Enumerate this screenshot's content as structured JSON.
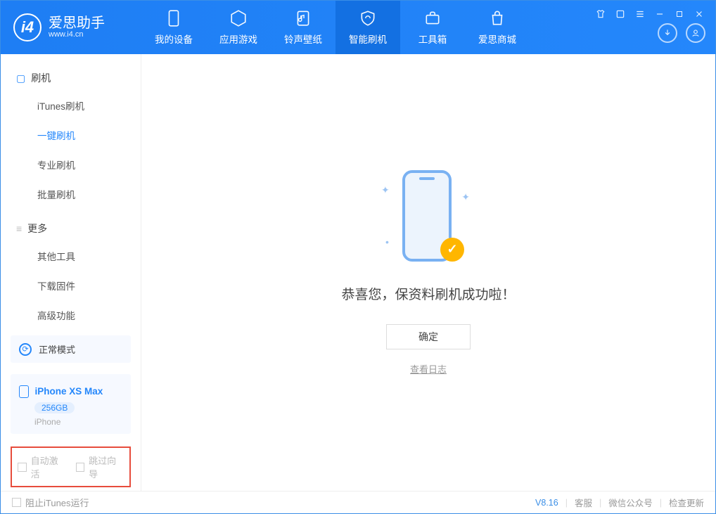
{
  "app": {
    "name": "爱思助手",
    "url": "www.i4.cn"
  },
  "tabs": [
    {
      "label": "我的设备"
    },
    {
      "label": "应用游戏"
    },
    {
      "label": "铃声壁纸"
    },
    {
      "label": "智能刷机"
    },
    {
      "label": "工具箱"
    },
    {
      "label": "爱思商城"
    }
  ],
  "sidebar": {
    "group1": {
      "title": "刷机",
      "items": [
        "iTunes刷机",
        "一键刷机",
        "专业刷机",
        "批量刷机"
      ]
    },
    "group2": {
      "title": "更多",
      "items": [
        "其他工具",
        "下载固件",
        "高级功能"
      ]
    }
  },
  "mode": {
    "label": "正常模式"
  },
  "device": {
    "name": "iPhone XS Max",
    "storage": "256GB",
    "type": "iPhone"
  },
  "checks": {
    "auto_activate": "自动激活",
    "skip_guide": "跳过向导"
  },
  "main": {
    "message": "恭喜您，保资料刷机成功啦！",
    "confirm": "确定",
    "view_log": "查看日志"
  },
  "footer": {
    "block_itunes": "阻止iTunes运行",
    "version": "V8.16",
    "service": "客服",
    "wechat": "微信公众号",
    "update": "检查更新"
  }
}
